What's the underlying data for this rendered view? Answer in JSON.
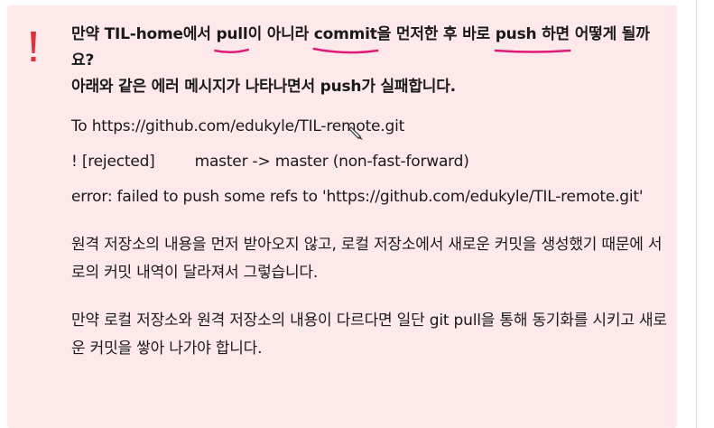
{
  "callout": {
    "icon": "exclamation-icon",
    "accent_color": "#e0303a",
    "background": "#fde8ea",
    "title": {
      "seg1": "만약 TIL-home에서 ",
      "pull": "pull",
      "seg2": "이 아니라 ",
      "commit": "commit",
      "seg3": "을 먼저한 후 바로 ",
      "push_hamyeon": "push 하면",
      "seg4": " 어떻게 될까요?",
      "line2": "아래와 같은 에러 메시지가 나타나면서 push가 실패합니다."
    },
    "error_lines": {
      "to_line": "To https://github.com/edukyle/TIL-remote.git",
      "rejected_left": "! [rejected]",
      "rejected_right": "master -> master (non-fast-forward)",
      "error_line": "error: failed to push some refs to 'https://github.com/edukyle/TIL-remote.git'"
    },
    "explanation": "원격 저장소의 내용을 먼저 받아오지 않고, 로컬 저장소에서 새로운 커밋을 생성했기 때문에 서로의 커밋 내역이 달라져서 그렇습니다.",
    "solution": "만약 로컬 저장소와 원격 저장소의 내용이 다르다면 일단 git pull을 통해 동기화를 시키고 새로운 커밋을 쌓아 나가야 합니다."
  },
  "annotation_color": "#e0187a"
}
